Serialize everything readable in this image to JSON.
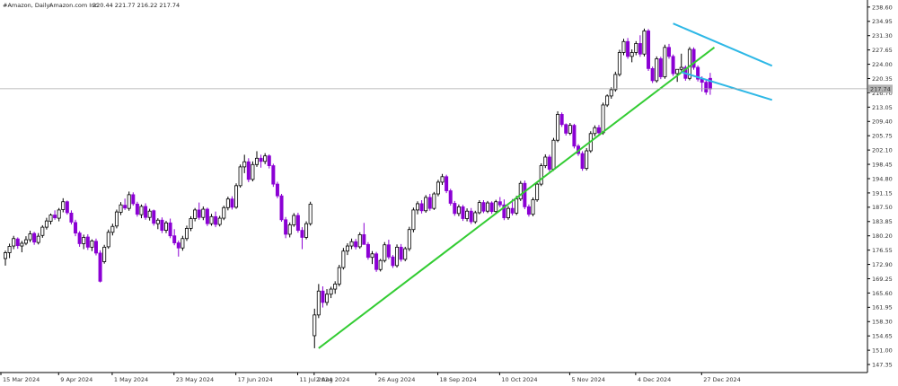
{
  "header": {
    "symbol": "#Amazon, Daily:",
    "name": "Amazon.com Inc.",
    "ohlc": "220.44 221.77 216.22 217.74"
  },
  "price_tag": "217.74",
  "colors": {
    "bull_fill": "#ffffff",
    "bull_stroke": "#000000",
    "bear": "#8b00d4",
    "support_line": "#33cc33",
    "channel_lines": "#2eb8e6",
    "price_line": "#aaaaaa",
    "price_tag_bg": "#b3b3b3",
    "axis": "#000000"
  },
  "chart_data": {
    "type": "candlestick",
    "title": "#Amazon, Daily:  Amazon.com Inc.",
    "ylim": [
      145.3,
      240.4
    ],
    "ytick_labels": [
      "238.60",
      "234.95",
      "231.30",
      "227.65",
      "224.00",
      "220.35",
      "216.70",
      "213.05",
      "209.40",
      "205.75",
      "202.10",
      "198.45",
      "194.80",
      "191.15",
      "187.50",
      "183.85",
      "180.20",
      "176.55",
      "172.90",
      "169.25",
      "165.60",
      "161.95",
      "158.30",
      "154.65",
      "151.00",
      "147.35"
    ],
    "xtick_labels": [
      "15 Mar 2024",
      "9 Apr 2024",
      "1 May 2024",
      "23 May 2024",
      "17 Jun 2024",
      "11 Jul 2024",
      "2 Aug 2024",
      "26 Aug 2024",
      "18 Sep 2024",
      "10 Oct 2024",
      "5 Nov 2024",
      "4 Dec 2024",
      "27 Dec 2024"
    ],
    "last_price": 217.74,
    "candles": [
      {
        "o": 174.4,
        "h": 176.4,
        "l": 172.6,
        "c": 175.9
      },
      {
        "o": 175.9,
        "h": 178.2,
        "l": 174.5,
        "c": 177.5
      },
      {
        "o": 177.6,
        "h": 180.2,
        "l": 176.8,
        "c": 179.5
      },
      {
        "o": 179.4,
        "h": 179.8,
        "l": 176.9,
        "c": 177.7
      },
      {
        "o": 177.6,
        "h": 178.9,
        "l": 176.0,
        "c": 178.3
      },
      {
        "o": 178.3,
        "h": 180.1,
        "l": 177.8,
        "c": 179.2
      },
      {
        "o": 179.2,
        "h": 181.5,
        "l": 178.6,
        "c": 180.7
      },
      {
        "o": 180.8,
        "h": 181.2,
        "l": 177.9,
        "c": 178.6
      },
      {
        "o": 178.5,
        "h": 180.9,
        "l": 178.0,
        "c": 180.1
      },
      {
        "o": 180.3,
        "h": 182.9,
        "l": 179.7,
        "c": 182.4
      },
      {
        "o": 182.4,
        "h": 184.8,
        "l": 181.8,
        "c": 184.0
      },
      {
        "o": 183.9,
        "h": 185.9,
        "l": 183.1,
        "c": 185.5
      },
      {
        "o": 185.5,
        "h": 186.7,
        "l": 184.3,
        "c": 184.8
      },
      {
        "o": 184.7,
        "h": 187.3,
        "l": 183.9,
        "c": 186.8
      },
      {
        "o": 186.9,
        "h": 189.8,
        "l": 186.2,
        "c": 188.9
      },
      {
        "o": 188.9,
        "h": 189.2,
        "l": 185.6,
        "c": 186.1
      },
      {
        "o": 186.0,
        "h": 186.7,
        "l": 183.1,
        "c": 183.7
      },
      {
        "o": 183.6,
        "h": 184.3,
        "l": 180.1,
        "c": 180.9
      },
      {
        "o": 180.9,
        "h": 181.4,
        "l": 177.4,
        "c": 178.2
      },
      {
        "o": 178.2,
        "h": 180.5,
        "l": 176.8,
        "c": 179.8
      },
      {
        "o": 179.9,
        "h": 180.6,
        "l": 176.6,
        "c": 177.3
      },
      {
        "o": 177.3,
        "h": 179.3,
        "l": 176.3,
        "c": 178.9
      },
      {
        "o": 178.8,
        "h": 179.5,
        "l": 175.2,
        "c": 175.8
      },
      {
        "o": 175.8,
        "h": 176.5,
        "l": 168.3,
        "c": 168.6
      },
      {
        "o": 173.6,
        "h": 177.9,
        "l": 173.1,
        "c": 177.3
      },
      {
        "o": 177.4,
        "h": 181.8,
        "l": 176.9,
        "c": 181.1
      },
      {
        "o": 181.1,
        "h": 183.3,
        "l": 180.3,
        "c": 182.6
      },
      {
        "o": 182.7,
        "h": 186.9,
        "l": 182.1,
        "c": 186.3
      },
      {
        "o": 186.2,
        "h": 188.8,
        "l": 185.5,
        "c": 188.1
      },
      {
        "o": 188.0,
        "h": 189.7,
        "l": 186.8,
        "c": 187.3
      },
      {
        "o": 187.2,
        "h": 191.5,
        "l": 186.6,
        "c": 190.7
      },
      {
        "o": 190.7,
        "h": 191.3,
        "l": 187.9,
        "c": 188.4
      },
      {
        "o": 188.3,
        "h": 188.9,
        "l": 185.1,
        "c": 185.7
      },
      {
        "o": 185.6,
        "h": 188.2,
        "l": 184.7,
        "c": 187.7
      },
      {
        "o": 187.7,
        "h": 188.5,
        "l": 184.3,
        "c": 184.9
      },
      {
        "o": 184.9,
        "h": 187.1,
        "l": 184.1,
        "c": 186.5
      },
      {
        "o": 186.6,
        "h": 186.9,
        "l": 182.8,
        "c": 183.4
      },
      {
        "o": 183.3,
        "h": 184.7,
        "l": 181.9,
        "c": 184.2
      },
      {
        "o": 184.2,
        "h": 184.9,
        "l": 180.9,
        "c": 181.6
      },
      {
        "o": 181.6,
        "h": 184.0,
        "l": 180.9,
        "c": 183.5
      },
      {
        "o": 183.5,
        "h": 184.6,
        "l": 179.6,
        "c": 180.2
      },
      {
        "o": 180.2,
        "h": 181.9,
        "l": 177.8,
        "c": 178.4
      },
      {
        "o": 178.4,
        "h": 179.0,
        "l": 174.9,
        "c": 177.1
      },
      {
        "o": 177.1,
        "h": 180.2,
        "l": 176.4,
        "c": 179.5
      },
      {
        "o": 179.5,
        "h": 182.8,
        "l": 178.9,
        "c": 182.1
      },
      {
        "o": 182.1,
        "h": 185.2,
        "l": 181.4,
        "c": 184.6
      },
      {
        "o": 184.6,
        "h": 187.3,
        "l": 183.9,
        "c": 186.8
      },
      {
        "o": 186.8,
        "h": 188.7,
        "l": 184.3,
        "c": 184.9
      },
      {
        "o": 184.9,
        "h": 187.7,
        "l": 184.2,
        "c": 187.0
      },
      {
        "o": 187.0,
        "h": 187.4,
        "l": 182.7,
        "c": 183.3
      },
      {
        "o": 183.3,
        "h": 185.8,
        "l": 182.8,
        "c": 185.1
      },
      {
        "o": 185.1,
        "h": 186.4,
        "l": 182.4,
        "c": 183.1
      },
      {
        "o": 183.1,
        "h": 185.3,
        "l": 182.6,
        "c": 184.7
      },
      {
        "o": 184.7,
        "h": 187.9,
        "l": 184.2,
        "c": 187.4
      },
      {
        "o": 187.4,
        "h": 190.2,
        "l": 186.7,
        "c": 189.6
      },
      {
        "o": 189.6,
        "h": 190.3,
        "l": 186.9,
        "c": 187.5
      },
      {
        "o": 187.5,
        "h": 193.6,
        "l": 187.1,
        "c": 193.0
      },
      {
        "o": 193.0,
        "h": 198.4,
        "l": 192.5,
        "c": 197.8
      },
      {
        "o": 197.8,
        "h": 200.9,
        "l": 196.2,
        "c": 199.1
      },
      {
        "o": 199.1,
        "h": 200.0,
        "l": 193.9,
        "c": 194.6
      },
      {
        "o": 194.6,
        "h": 199.2,
        "l": 194.1,
        "c": 198.4
      },
      {
        "o": 198.4,
        "h": 201.8,
        "l": 197.8,
        "c": 200.0
      },
      {
        "o": 200.0,
        "h": 200.9,
        "l": 197.6,
        "c": 199.2
      },
      {
        "o": 199.2,
        "h": 201.3,
        "l": 198.5,
        "c": 200.6
      },
      {
        "o": 200.6,
        "h": 201.0,
        "l": 197.4,
        "c": 198.1
      },
      {
        "o": 198.1,
        "h": 198.6,
        "l": 192.7,
        "c": 193.4
      },
      {
        "o": 193.4,
        "h": 194.0,
        "l": 189.8,
        "c": 190.4
      },
      {
        "o": 190.4,
        "h": 190.9,
        "l": 183.8,
        "c": 184.3
      },
      {
        "o": 184.3,
        "h": 185.0,
        "l": 179.6,
        "c": 180.6
      },
      {
        "o": 180.6,
        "h": 183.6,
        "l": 179.8,
        "c": 183.0
      },
      {
        "o": 183.0,
        "h": 186.0,
        "l": 182.5,
        "c": 185.4
      },
      {
        "o": 185.4,
        "h": 186.1,
        "l": 181.0,
        "c": 181.6
      },
      {
        "o": 181.6,
        "h": 182.4,
        "l": 176.8,
        "c": 179.8
      },
      {
        "o": 179.8,
        "h": 183.9,
        "l": 179.3,
        "c": 183.3
      },
      {
        "o": 183.3,
        "h": 188.9,
        "l": 182.8,
        "c": 188.3
      },
      {
        "o": 154.7,
        "h": 161.6,
        "l": 151.5,
        "c": 160.0
      },
      {
        "o": 160.0,
        "h": 167.9,
        "l": 159.2,
        "c": 166.1
      },
      {
        "o": 166.1,
        "h": 167.3,
        "l": 161.9,
        "c": 163.2
      },
      {
        "o": 163.2,
        "h": 166.6,
        "l": 162.4,
        "c": 165.3
      },
      {
        "o": 165.3,
        "h": 167.2,
        "l": 164.3,
        "c": 166.6
      },
      {
        "o": 166.6,
        "h": 168.6,
        "l": 165.4,
        "c": 167.9
      },
      {
        "o": 167.9,
        "h": 172.8,
        "l": 167.3,
        "c": 172.1
      },
      {
        "o": 172.1,
        "h": 177.1,
        "l": 171.6,
        "c": 176.3
      },
      {
        "o": 176.3,
        "h": 178.3,
        "l": 175.3,
        "c": 177.6
      },
      {
        "o": 177.6,
        "h": 179.5,
        "l": 176.8,
        "c": 178.7
      },
      {
        "o": 178.7,
        "h": 179.4,
        "l": 176.7,
        "c": 177.4
      },
      {
        "o": 177.4,
        "h": 181.1,
        "l": 176.9,
        "c": 180.5
      },
      {
        "o": 180.5,
        "h": 183.5,
        "l": 180.0,
        "c": 178.0
      },
      {
        "o": 178.0,
        "h": 178.6,
        "l": 174.1,
        "c": 174.7
      },
      {
        "o": 174.7,
        "h": 176.3,
        "l": 173.0,
        "c": 175.6
      },
      {
        "o": 175.6,
        "h": 176.1,
        "l": 171.0,
        "c": 171.6
      },
      {
        "o": 171.6,
        "h": 174.3,
        "l": 171.1,
        "c": 173.9
      },
      {
        "o": 173.9,
        "h": 178.6,
        "l": 173.4,
        "c": 177.9
      },
      {
        "o": 177.9,
        "h": 179.2,
        "l": 174.2,
        "c": 174.8
      },
      {
        "o": 174.8,
        "h": 175.3,
        "l": 172.0,
        "c": 172.6
      },
      {
        "o": 172.6,
        "h": 178.0,
        "l": 172.1,
        "c": 177.3
      },
      {
        "o": 177.3,
        "h": 178.1,
        "l": 173.6,
        "c": 174.2
      },
      {
        "o": 174.2,
        "h": 177.4,
        "l": 173.7,
        "c": 176.9
      },
      {
        "o": 176.9,
        "h": 182.5,
        "l": 176.3,
        "c": 181.8
      },
      {
        "o": 181.8,
        "h": 187.4,
        "l": 181.1,
        "c": 186.8
      },
      {
        "o": 186.8,
        "h": 189.0,
        "l": 185.7,
        "c": 188.4
      },
      {
        "o": 188.4,
        "h": 189.3,
        "l": 185.9,
        "c": 186.6
      },
      {
        "o": 186.6,
        "h": 190.6,
        "l": 186.1,
        "c": 190.0
      },
      {
        "o": 190.0,
        "h": 190.9,
        "l": 186.6,
        "c": 187.2
      },
      {
        "o": 187.2,
        "h": 191.4,
        "l": 186.8,
        "c": 190.9
      },
      {
        "o": 190.9,
        "h": 194.5,
        "l": 190.3,
        "c": 193.9
      },
      {
        "o": 193.9,
        "h": 196.0,
        "l": 193.2,
        "c": 195.3
      },
      {
        "o": 195.3,
        "h": 195.8,
        "l": 191.1,
        "c": 191.7
      },
      {
        "o": 191.7,
        "h": 192.2,
        "l": 187.9,
        "c": 188.5
      },
      {
        "o": 188.5,
        "h": 189.1,
        "l": 185.3,
        "c": 185.9
      },
      {
        "o": 185.9,
        "h": 188.2,
        "l": 185.2,
        "c": 187.6
      },
      {
        "o": 187.6,
        "h": 188.1,
        "l": 184.0,
        "c": 184.6
      },
      {
        "o": 184.6,
        "h": 187.2,
        "l": 183.9,
        "c": 186.5
      },
      {
        "o": 186.5,
        "h": 187.3,
        "l": 183.2,
        "c": 183.8
      },
      {
        "o": 183.8,
        "h": 186.6,
        "l": 183.3,
        "c": 186.1
      },
      {
        "o": 186.1,
        "h": 189.3,
        "l": 185.7,
        "c": 188.7
      },
      {
        "o": 188.7,
        "h": 189.3,
        "l": 186.0,
        "c": 186.5
      },
      {
        "o": 186.5,
        "h": 189.1,
        "l": 186.0,
        "c": 188.6
      },
      {
        "o": 188.6,
        "h": 189.0,
        "l": 185.8,
        "c": 186.4
      },
      {
        "o": 186.4,
        "h": 189.4,
        "l": 185.9,
        "c": 188.9
      },
      {
        "o": 188.9,
        "h": 190.1,
        "l": 187.5,
        "c": 188.1
      },
      {
        "o": 188.1,
        "h": 189.5,
        "l": 184.2,
        "c": 184.8
      },
      {
        "o": 184.8,
        "h": 187.8,
        "l": 184.3,
        "c": 187.2
      },
      {
        "o": 187.2,
        "h": 189.6,
        "l": 185.4,
        "c": 186.0
      },
      {
        "o": 186.0,
        "h": 190.4,
        "l": 185.5,
        "c": 189.6
      },
      {
        "o": 189.6,
        "h": 194.2,
        "l": 189.1,
        "c": 193.6
      },
      {
        "o": 193.6,
        "h": 194.3,
        "l": 187.0,
        "c": 187.6
      },
      {
        "o": 187.6,
        "h": 188.2,
        "l": 185.1,
        "c": 185.7
      },
      {
        "o": 185.7,
        "h": 190.0,
        "l": 185.2,
        "c": 189.4
      },
      {
        "o": 189.4,
        "h": 194.0,
        "l": 188.9,
        "c": 193.4
      },
      {
        "o": 193.4,
        "h": 198.7,
        "l": 192.9,
        "c": 198.1
      },
      {
        "o": 198.1,
        "h": 201.0,
        "l": 197.5,
        "c": 200.3
      },
      {
        "o": 200.3,
        "h": 200.9,
        "l": 196.6,
        "c": 197.2
      },
      {
        "o": 197.2,
        "h": 205.2,
        "l": 196.8,
        "c": 204.6
      },
      {
        "o": 204.6,
        "h": 212.0,
        "l": 204.1,
        "c": 211.2
      },
      {
        "o": 211.2,
        "h": 211.7,
        "l": 208.0,
        "c": 208.6
      },
      {
        "o": 208.6,
        "h": 208.9,
        "l": 205.8,
        "c": 206.4
      },
      {
        "o": 206.4,
        "h": 209.0,
        "l": 205.9,
        "c": 208.4
      },
      {
        "o": 208.4,
        "h": 208.8,
        "l": 202.5,
        "c": 203.1
      },
      {
        "o": 203.1,
        "h": 203.6,
        "l": 200.6,
        "c": 201.2
      },
      {
        "o": 201.2,
        "h": 201.8,
        "l": 196.8,
        "c": 197.4
      },
      {
        "o": 197.4,
        "h": 202.6,
        "l": 196.9,
        "c": 201.9
      },
      {
        "o": 201.9,
        "h": 206.9,
        "l": 201.4,
        "c": 206.3
      },
      {
        "o": 206.3,
        "h": 208.4,
        "l": 205.6,
        "c": 207.8
      },
      {
        "o": 207.8,
        "h": 208.5,
        "l": 205.9,
        "c": 206.5
      },
      {
        "o": 206.5,
        "h": 214.2,
        "l": 206.0,
        "c": 213.6
      },
      {
        "o": 213.6,
        "h": 216.3,
        "l": 213.1,
        "c": 215.9
      },
      {
        "o": 215.9,
        "h": 218.1,
        "l": 215.2,
        "c": 217.5
      },
      {
        "o": 217.5,
        "h": 222.1,
        "l": 217.0,
        "c": 221.4
      },
      {
        "o": 221.4,
        "h": 227.7,
        "l": 220.9,
        "c": 227.0
      },
      {
        "o": 227.0,
        "h": 230.5,
        "l": 226.3,
        "c": 229.8
      },
      {
        "o": 229.8,
        "h": 230.7,
        "l": 225.4,
        "c": 226.0
      },
      {
        "o": 226.0,
        "h": 227.8,
        "l": 224.5,
        "c": 227.0
      },
      {
        "o": 227.0,
        "h": 229.9,
        "l": 226.3,
        "c": 229.3
      },
      {
        "o": 229.3,
        "h": 231.4,
        "l": 225.9,
        "c": 226.6
      },
      {
        "o": 226.6,
        "h": 233.1,
        "l": 226.0,
        "c": 232.5
      },
      {
        "o": 232.5,
        "h": 233.0,
        "l": 222.3,
        "c": 222.9
      },
      {
        "o": 222.9,
        "h": 223.4,
        "l": 219.2,
        "c": 219.8
      },
      {
        "o": 219.8,
        "h": 226.0,
        "l": 219.3,
        "c": 225.4
      },
      {
        "o": 225.4,
        "h": 225.9,
        "l": 220.2,
        "c": 220.8
      },
      {
        "o": 220.8,
        "h": 229.0,
        "l": 220.3,
        "c": 228.3
      },
      {
        "o": 228.3,
        "h": 229.2,
        "l": 225.4,
        "c": 226.0
      },
      {
        "o": 226.0,
        "h": 226.5,
        "l": 221.0,
        "c": 221.6
      },
      {
        "o": 221.6,
        "h": 222.2,
        "l": 219.5,
        "c": 222.7
      },
      {
        "o": 222.7,
        "h": 226.7,
        "l": 222.2,
        "c": 223.2
      },
      {
        "o": 223.2,
        "h": 223.7,
        "l": 219.8,
        "c": 220.4
      },
      {
        "o": 220.4,
        "h": 228.4,
        "l": 219.9,
        "c": 227.8
      },
      {
        "o": 227.8,
        "h": 228.3,
        "l": 222.6,
        "c": 223.2
      },
      {
        "o": 223.2,
        "h": 223.7,
        "l": 219.6,
        "c": 220.2
      },
      {
        "o": 220.2,
        "h": 220.9,
        "l": 217.0,
        "c": 219.4
      },
      {
        "o": 219.4,
        "h": 220.0,
        "l": 216.2,
        "c": 216.9
      },
      {
        "o": 220.4,
        "h": 221.8,
        "l": 216.2,
        "c": 217.7
      }
    ],
    "trendlines": [
      {
        "name": "support",
        "x1": 76,
        "y1": 151.5,
        "x2": 172,
        "y2": 228.3
      },
      {
        "name": "channel-upper",
        "x1": 162,
        "y1": 234.4,
        "x2": 186,
        "y2": 223.6
      },
      {
        "name": "channel-lower",
        "x1": 164,
        "y1": 222.0,
        "x2": 186,
        "y2": 214.9
      }
    ],
    "grid": false,
    "legend": "none"
  }
}
